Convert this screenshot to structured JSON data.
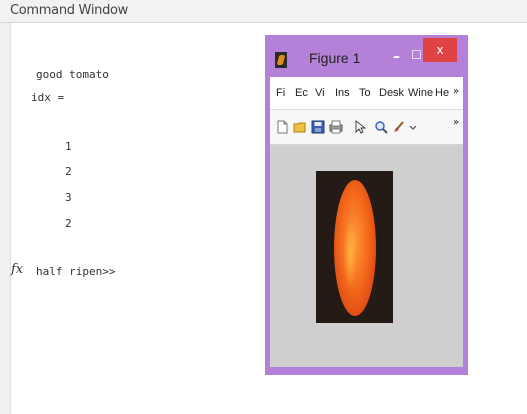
{
  "command_window": {
    "title": "Command Window",
    "lines": [
      "good tomato",
      "idx =",
      "1",
      "2",
      "3",
      "2"
    ],
    "fx_symbol": "fx",
    "prompt_line": "half ripen>>"
  },
  "figure": {
    "title": "Figure 1",
    "window_controls": {
      "minimize": "–",
      "maximize": "☐",
      "close": "x"
    },
    "menu": [
      "Fi",
      "Ec",
      "Vi",
      "Ins",
      "To",
      "Desk",
      "Wine",
      "He"
    ],
    "menu_more": "»",
    "toolbar_icons": [
      "new-file-icon",
      "open-folder-icon",
      "save-icon",
      "print-icon",
      "pointer-icon",
      "zoom-icon",
      "brush-icon"
    ],
    "toolbar_more": "»",
    "image": "papaya-photo"
  },
  "colors": {
    "figure_frame": "#b480d8",
    "close_button": "#e04343",
    "canvas_bg": "#cfcfcf"
  }
}
